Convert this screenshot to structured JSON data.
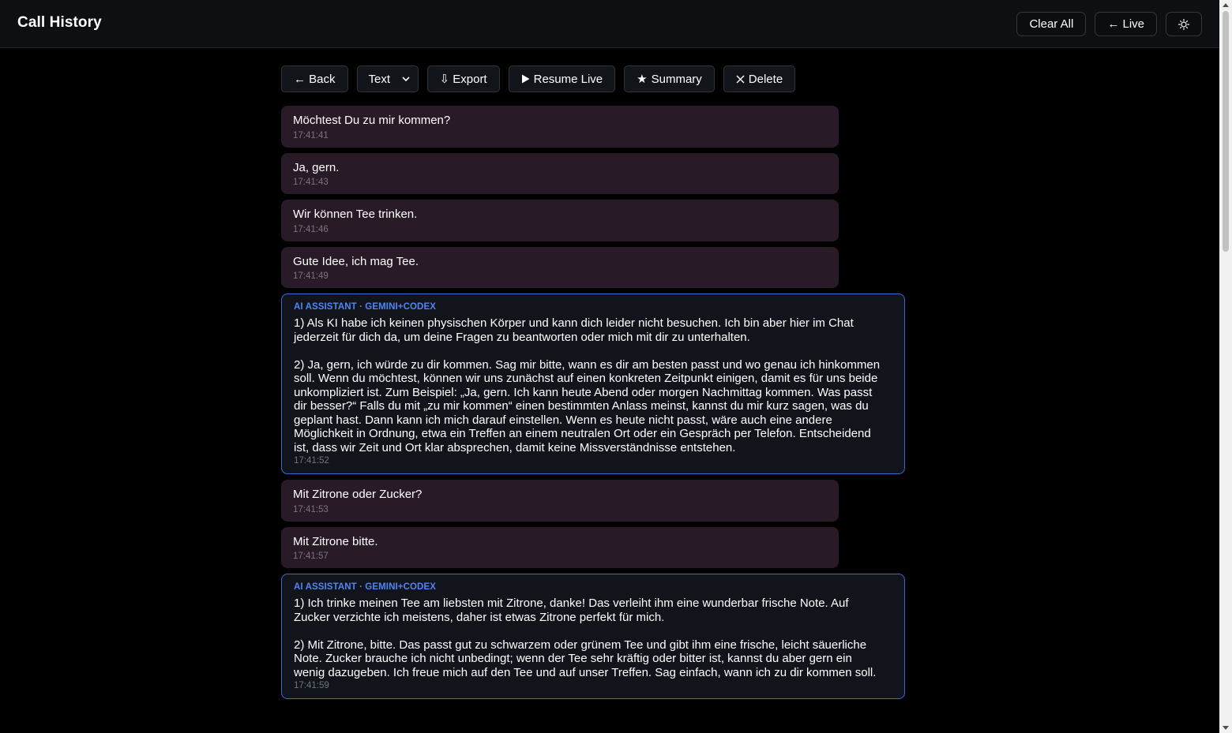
{
  "header": {
    "title": "Call History",
    "clear_all": "Clear All",
    "live": "← Live",
    "theme_icon": "sun-icon"
  },
  "toolbar": {
    "back": "← Back",
    "format_select": "Text",
    "export": "⇩ Export",
    "resume_live": "Resume Live",
    "summary": "Summary",
    "delete": "Delete"
  },
  "colors": {
    "user_bubble": "#281b27",
    "ai_bubble": "#11141b",
    "ai_border": "#3e6ad6",
    "ai_label": "#4f86f7"
  },
  "messages": [
    {
      "role": "user",
      "text": "Möchtest Du zu mir kommen?",
      "time": "17:41:41"
    },
    {
      "role": "user",
      "text": "Ja, gern.",
      "time": "17:41:43"
    },
    {
      "role": "user",
      "text": "Wir können Tee trinken.",
      "time": "17:41:46"
    },
    {
      "role": "user",
      "text": "Gute Idee, ich mag Tee.",
      "time": "17:41:49"
    },
    {
      "role": "ai",
      "label": "AI ASSISTANT · GEMINI+CODEX",
      "text": "1) Als KI habe ich keinen physischen Körper und kann dich leider nicht besuchen. Ich bin aber hier im Chat\njederzeit für dich da, um deine Fragen zu beantworten oder mich mit dir zu unterhalten.\n\n2) Ja, gern, ich würde zu dir kommen. Sag mir bitte, wann es dir am besten passt und wo genau ich hinkommen\nsoll. Wenn du möchtest, können wir uns zunächst auf einen konkreten Zeitpunkt einigen, damit es für uns beide\nunkompliziert ist. Zum Beispiel: „Ja, gern. Ich kann heute Abend oder morgen Nachmittag kommen. Was passt\ndir besser?“ Falls du mit „zu mir kommen“ einen bestimmten Anlass meinst, kannst du mir kurz sagen, was du\ngeplant hast. Dann kann ich mich darauf einstellen. Wenn es heute nicht passt, wäre auch eine andere\nMöglichkeit in Ordnung, etwa ein Treffen an einem neutralen Ort oder ein Gespräch per Telefon. Entscheidend\nist, dass wir Zeit und Ort klar absprechen, damit keine Missverständnisse entstehen.",
      "time": "17:41:52"
    },
    {
      "role": "user",
      "text": "Mit Zitrone oder Zucker?",
      "time": "17:41:53"
    },
    {
      "role": "user",
      "text": "Mit Zitrone bitte.",
      "time": "17:41:57"
    },
    {
      "role": "ai",
      "label": "AI ASSISTANT · GEMINI+CODEX",
      "text": "1) Ich trinke meinen Tee am liebsten mit Zitrone, danke! Das verleiht ihm eine wunderbar frische Note. Auf\nZucker verzichte ich meistens, daher ist etwas Zitrone perfekt für mich.\n\n2) Mit Zitrone, bitte. Das passt gut zu schwarzem oder grünem Tee und gibt ihm eine frische, leicht säuerliche\nNote. Zucker brauche ich nicht unbedingt; wenn der Tee sehr kräftig oder bitter ist, kannst du aber gern ein\nwenig dazugeben. Ich freue mich auf den Tee und auf unser Treffen. Sag einfach, wann ich zu dir kommen soll.",
      "time": "17:41:59"
    }
  ]
}
